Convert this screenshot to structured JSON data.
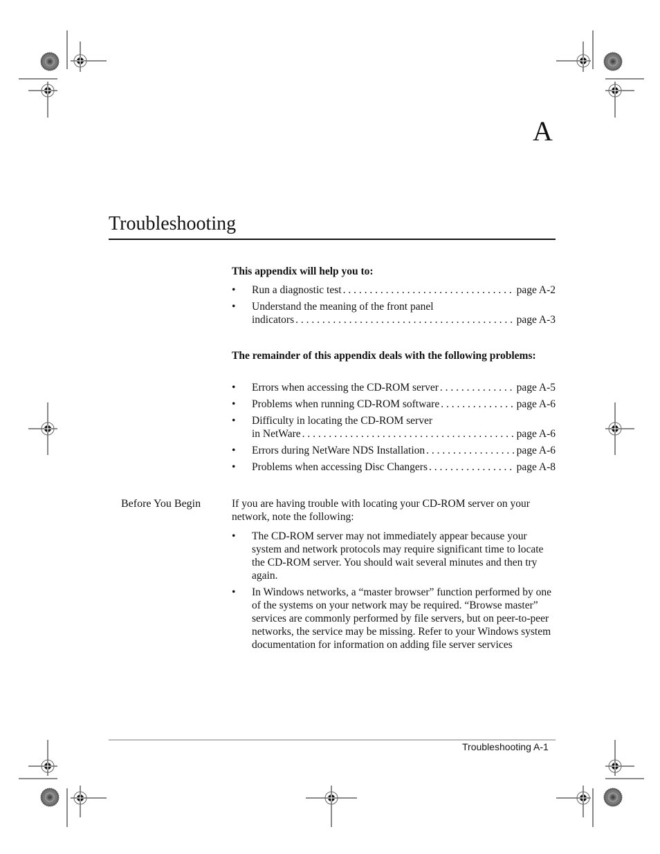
{
  "chapter_letter": "A",
  "title": "Troubleshooting",
  "section1": {
    "heading": "This appendix will help you to:",
    "items": [
      {
        "lines": [],
        "last": "Run a diagnostic test",
        "page": "page A-2"
      },
      {
        "lines": [
          "Understand the meaning of the front panel"
        ],
        "last": "indicators",
        "page": "page A-3"
      }
    ]
  },
  "section2": {
    "heading": "The remainder of this appendix deals with the following problems:",
    "items": [
      {
        "first": "",
        "last": "Errors when accessing the CD-ROM server",
        "page": "page A-5"
      },
      {
        "first": "",
        "last": "Problems when running CD-ROM software",
        "page": "page A-6"
      },
      {
        "first": "Difficulty in locating the CD-ROM server",
        "last": "in NetWare",
        "page": "page A-6"
      },
      {
        "first": "",
        "last": "Errors during NetWare NDS Installation",
        "page": "page A-6"
      },
      {
        "first": "",
        "last": "Problems when accessing Disc Changers",
        "page": "page A-8"
      }
    ]
  },
  "before_you_begin": {
    "label": "Before You Begin",
    "intro": "If you are having trouble with locating your CD-ROM server on your network, note the following:",
    "items": [
      "The CD-ROM server may not immediately appear because your system and network protocols may require significant time to locate the CD-ROM server. You should wait several minutes and then try again.",
      "In Windows networks, a “master browser” function performed by one of the systems on your network may be required. “Browse master” services are commonly performed by file servers, but on peer-to-peer networks, the service may be missing.  Refer to your Windows system documentation for information on adding file server services"
    ]
  },
  "bullet_glyph": "•",
  "footer": "Troubleshooting A-1"
}
